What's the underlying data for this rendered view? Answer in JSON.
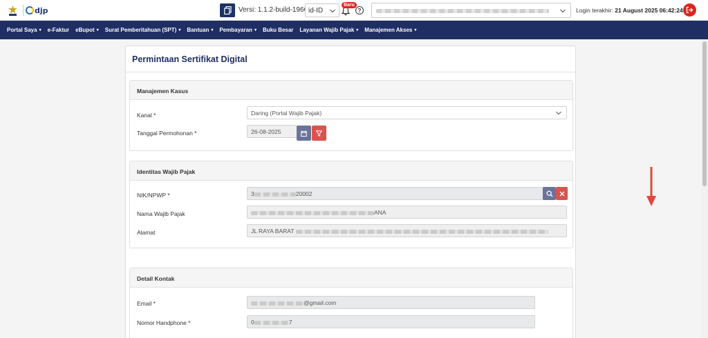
{
  "header": {
    "version_label": "Versi:",
    "version_value": "1.1.2-build-1966",
    "language": "id-ID",
    "new_badge": "Baru",
    "help_glyph": "?",
    "login_label": "Login terakhir:",
    "login_value": "21 August 2025 06:42:24"
  },
  "nav": {
    "items": [
      {
        "label": "Portal Saya",
        "dropdown": true
      },
      {
        "label": "e-Faktur",
        "dropdown": false
      },
      {
        "label": "eBupot",
        "dropdown": true
      },
      {
        "label": "Surat Pemberitahuan (SPT)",
        "dropdown": true
      },
      {
        "label": "Bantuan",
        "dropdown": true
      },
      {
        "label": "Pembayaran",
        "dropdown": true
      },
      {
        "label": "Buku Besar",
        "dropdown": false
      },
      {
        "label": "Layanan Wajib Pajak",
        "dropdown": true
      },
      {
        "label": "Manajemen Akses",
        "dropdown": true
      }
    ]
  },
  "page": {
    "title": "Permintaan Sertifikat Digital"
  },
  "manajemen_kasus": {
    "title": "Manajemen Kasus",
    "kanal_label": "Kanal *",
    "kanal_value": "Daring (Portal Wajib Pajak)",
    "tanggal_label": "Tanggal Permohonan *",
    "tanggal_value": "26-08-2025"
  },
  "identitas": {
    "title": "Identitas Wajib Pajak",
    "nik_label": "NIK/NPWP *",
    "nik_prefix": "3",
    "nik_suffix": "20002",
    "nama_label": "Nama Wajib Pajak",
    "nama_suffix": "ANA",
    "alamat_label": "Alamat",
    "alamat_prefix": "JL RAYA BARAT"
  },
  "kontak": {
    "title": "Detail Kontak",
    "email_label": "Email  *",
    "email_suffix": "@gmail.com",
    "hp_label": "Nomor Handphone  *",
    "hp_prefix": "0",
    "hp_suffix": "7"
  },
  "colors": {
    "navbar": "#1f2e63",
    "accent_red": "#d9251d",
    "button_slate": "#6a7398",
    "button_red": "#d9534f"
  }
}
